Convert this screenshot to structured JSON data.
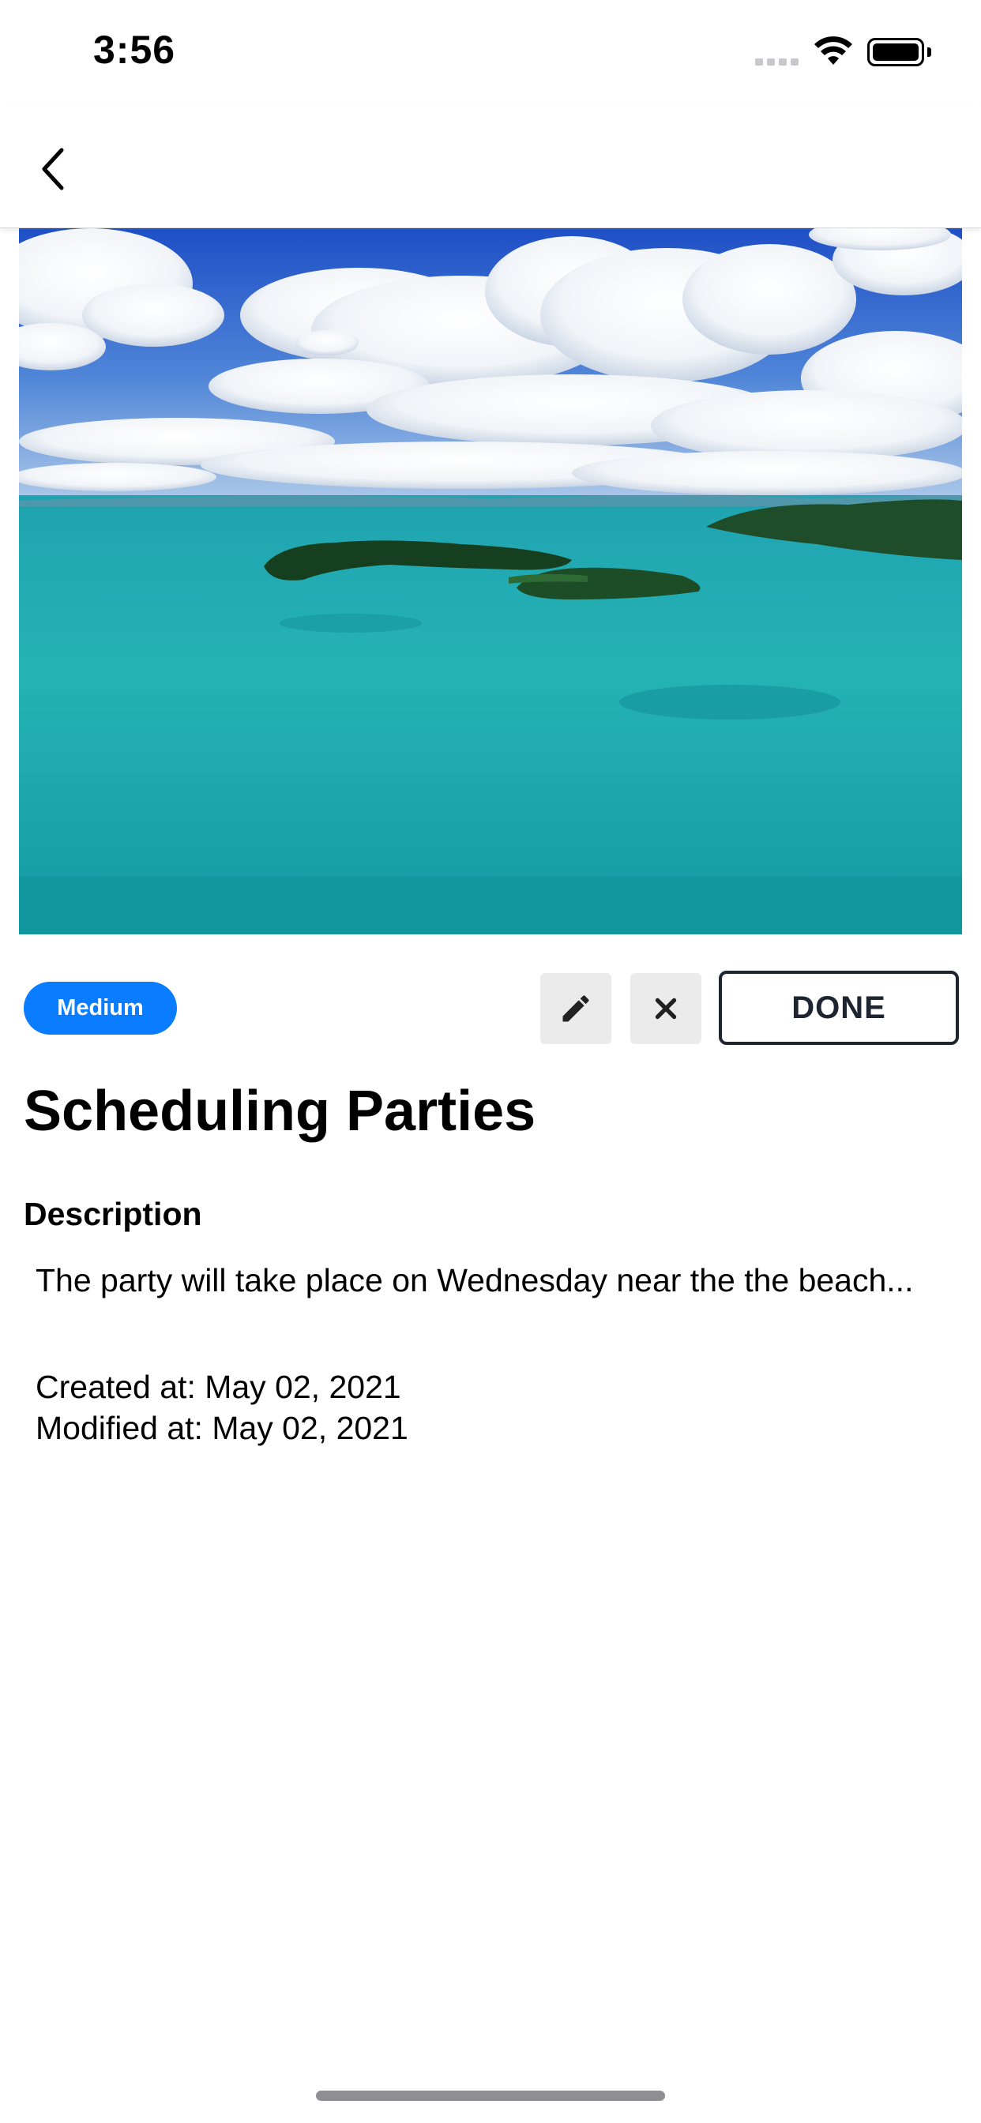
{
  "status_bar": {
    "time": "3:56"
  },
  "nav": {
    "back_icon": "chevron-left-icon"
  },
  "task": {
    "priority": "Medium",
    "done_label": "DONE",
    "title": "Scheduling Parties",
    "description_heading": "Description",
    "description": "The party will take place on Wednesday near the the beach...",
    "created": "Created at: May 02, 2021",
    "modified": "Modified at: May 02, 2021"
  },
  "colors": {
    "accent": "#0a7cff",
    "done_border": "#1e2530",
    "icon_button_bg": "#ebebeb"
  },
  "icons": {
    "edit": "pencil-icon",
    "delete": "close-icon"
  }
}
